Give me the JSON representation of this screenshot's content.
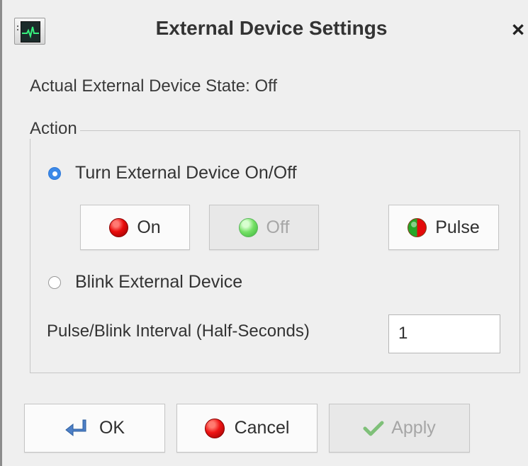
{
  "window": {
    "title": "External Device Settings",
    "close_glyph": "×",
    "app_icon": "external-device-monitor-icon"
  },
  "status": {
    "actual_state": "Actual External Device State: Off"
  },
  "action_group": {
    "title": "Action",
    "radio_turn": "Turn External Device On/Off",
    "radio_blink": "Blink External Device",
    "selected": "Turn External Device On/Off",
    "buttons": {
      "on": "On",
      "off": "Off",
      "pulse": "Pulse"
    },
    "interval_label": "Pulse/Blink Interval (Half-Seconds)",
    "interval_value": "1"
  },
  "footer": {
    "ok": "OK",
    "cancel": "Cancel",
    "apply": "Apply"
  },
  "colors": {
    "selected_radio": "#3c89e8",
    "red_led": "#e30a0a",
    "green_led": "#74e065",
    "disabled_text": "#a6a6a6"
  }
}
